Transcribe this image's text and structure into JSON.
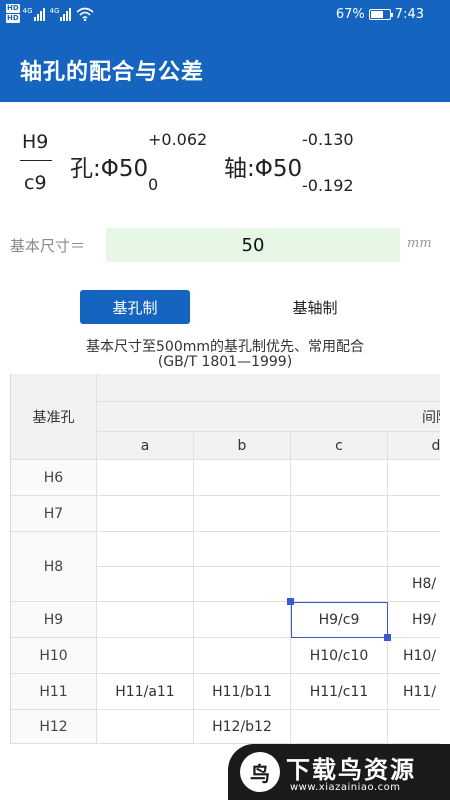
{
  "status_bar": {
    "hd_badges": [
      "HD",
      "HD"
    ],
    "network": [
      "4G",
      "4G"
    ],
    "battery_text": "67%",
    "battery_level": 0.67,
    "time": "7:43"
  },
  "app_bar": {
    "title": "轴孔的配合与公差"
  },
  "fit": {
    "numerator": "H9",
    "denominator": "c9",
    "hole_label": "孔:Φ50",
    "hole_upper": "+0.062",
    "hole_lower": "0",
    "shaft_label": "轴:Φ50",
    "shaft_upper": "-0.130",
    "shaft_lower": "-0.192"
  },
  "size_input": {
    "label": "基本尺寸＝",
    "value": "50",
    "unit": "mm"
  },
  "toggle": {
    "hole_basis": "基孔制",
    "shaft_basis": "基轴制"
  },
  "caption": {
    "line1": "基本尺寸至500mm的基孔制优先、常用配合",
    "line2": "(GB/T 1801—1999)"
  },
  "table": {
    "corner": "基准孔",
    "group": "间隙",
    "columns": [
      "a",
      "b",
      "c",
      "d"
    ],
    "rows": [
      "H6",
      "H7",
      "H8",
      "H9",
      "H10",
      "H11",
      "H12"
    ],
    "cells": {
      "h8_d": "H8/",
      "h9_c": "H9/c9",
      "h9_d": "H9/",
      "h10_c": "H10/c10",
      "h10_d": "H10/",
      "h11_a": "H11/a11",
      "h11_b": "H11/b11",
      "h11_c": "H11/c11",
      "h11_d": "H11/",
      "h12_b": "H12/b12"
    }
  },
  "watermark": {
    "logo": "鸟",
    "text": "下载鸟资源",
    "url": "www.xiazainiao.com"
  }
}
